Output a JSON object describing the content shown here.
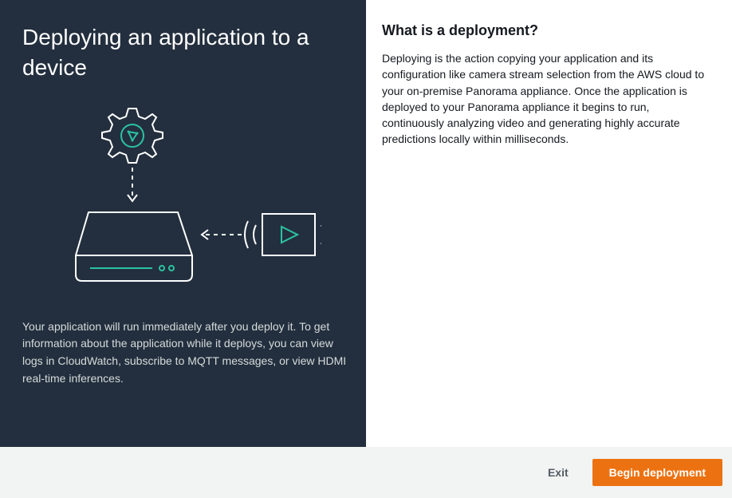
{
  "left": {
    "title": "Deploying an application to a device",
    "description": "Your application will run immediately after you deploy it. To get information about the application while it deploys, you can view logs in CloudWatch, subscribe to MQTT messages, or view HDMI real-time inferences."
  },
  "right": {
    "title": "What is a deployment?",
    "body": "Deploying is the action copying your application and its configuration like camera stream selection from the AWS cloud to your on-premise Panorama appliance. Once the application is deployed to your Panorama appliance it begins to run, continuously analyzing video and generating highly accurate predictions locally within milliseconds."
  },
  "footer": {
    "exit_label": "Exit",
    "begin_label": "Begin deployment"
  }
}
